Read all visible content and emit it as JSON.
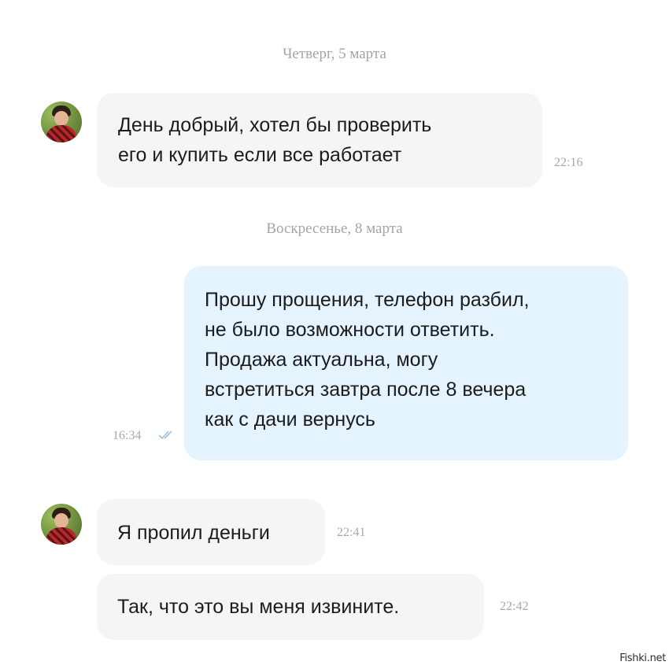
{
  "conversation": {
    "date_1": "Четверг, 5 марта",
    "date_2": "Воскресенье, 8 марта",
    "messages": [
      {
        "from": "other",
        "lines": [
          "День добрый, хотел бы проверить",
          "его и купить если все работает"
        ],
        "time": "22:16"
      },
      {
        "from": "me",
        "lines": [
          "Прошу прощения, телефон разбил,",
          "не было возможности ответить.",
          "Продажа актуальна, могу",
          "встретиться завтра после 8 вечера",
          "как с дачи вернусь"
        ],
        "time": "16:34",
        "status_icon": "double-check-icon"
      },
      {
        "from": "other",
        "lines": [
          "Я пропил деньги"
        ],
        "time": "22:41"
      },
      {
        "from": "other",
        "lines": [
          "Так, что это вы меня извините."
        ],
        "time": "22:42"
      }
    ]
  },
  "avatar_icon": "user-avatar-icon",
  "watermark": "Fishki.net",
  "colors": {
    "incoming_bubble": "#f5f5f5",
    "outgoing_bubble": "#e4f3fd",
    "meta_text": "#a8a8a8",
    "read_ticks": "#9fc3d6"
  }
}
